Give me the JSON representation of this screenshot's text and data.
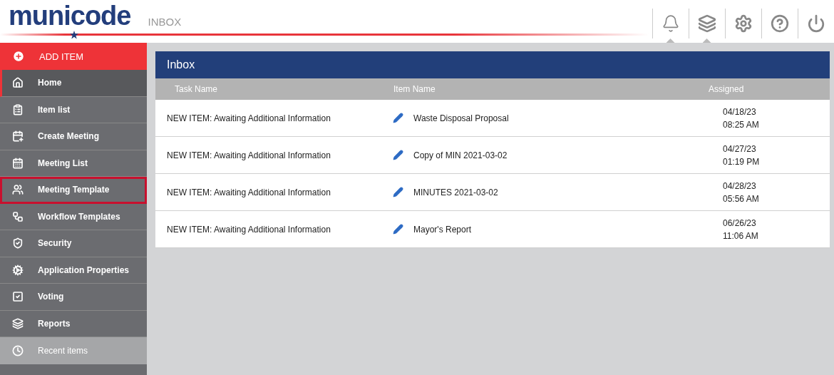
{
  "header": {
    "logo": "municode",
    "page_title": "INBOX"
  },
  "toolbar": [
    {
      "kind": "bell",
      "pointer": true
    },
    {
      "kind": "layers",
      "pointer": true
    },
    {
      "kind": "settings",
      "pointer": false
    },
    {
      "kind": "help",
      "pointer": false
    },
    {
      "kind": "power",
      "pointer": false
    }
  ],
  "sidebar": {
    "add_item": "ADD ITEM",
    "items": [
      {
        "label": "Home",
        "selected": true,
        "highlighted": false
      },
      {
        "label": "Item list",
        "selected": false,
        "highlighted": false
      },
      {
        "label": "Create Meeting",
        "selected": false,
        "highlighted": false
      },
      {
        "label": "Meeting List",
        "selected": false,
        "highlighted": false
      },
      {
        "label": "Meeting Template",
        "selected": false,
        "highlighted": true
      },
      {
        "label": "Workflow Templates",
        "selected": false,
        "highlighted": false
      },
      {
        "label": "Security",
        "selected": false,
        "highlighted": false
      },
      {
        "label": "Application Properties",
        "selected": false,
        "highlighted": false
      },
      {
        "label": "Voting",
        "selected": false,
        "highlighted": false
      },
      {
        "label": "Reports",
        "selected": false,
        "highlighted": false
      }
    ],
    "recent": "Recent items"
  },
  "inbox": {
    "title": "Inbox",
    "columns": [
      "Task Name",
      "Item Name",
      "Assigned"
    ],
    "rows": [
      {
        "task": "NEW ITEM: Awaiting Additional Information",
        "item": "Waste Disposal Proposal",
        "date": "04/18/23",
        "time": "08:25 AM"
      },
      {
        "task": "NEW ITEM: Awaiting Additional Information",
        "item": "Copy of MIN 2021-03-02",
        "date": "04/27/23",
        "time": "01:19 PM"
      },
      {
        "task": "NEW ITEM: Awaiting Additional Information",
        "item": "MINUTES 2021-03-02",
        "date": "04/28/23",
        "time": "05:56 AM"
      },
      {
        "task": "NEW ITEM: Awaiting Additional Information",
        "item": "Mayor's Report",
        "date": "06/26/23",
        "time": "11:06 AM"
      }
    ]
  }
}
